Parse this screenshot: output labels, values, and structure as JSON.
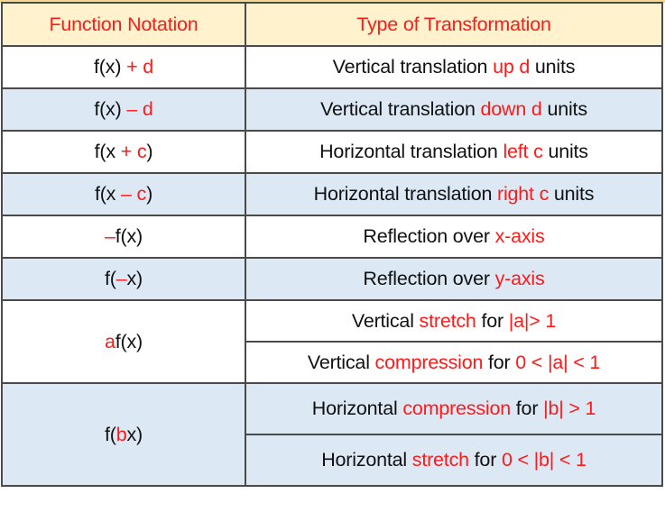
{
  "colors": {
    "header_bg": "#FFF2CC",
    "alt_row_bg": "#DDE8F5",
    "row_bg": "#FFFFFF",
    "accent_red": "#FF0000",
    "border": "#4A4A4A"
  },
  "table": {
    "headers": {
      "function_notation": "Function Notation",
      "type_of_transformation": "Type of Transformation"
    },
    "rows": [
      {
        "notation": [
          {
            "t": "f(x) ",
            "red": false
          },
          {
            "t": "+ d",
            "red": true
          }
        ],
        "transformation": [
          [
            {
              "t": "Vertical translation ",
              "red": false
            },
            {
              "t": "up d",
              "red": true
            },
            {
              "t": " units",
              "red": false
            }
          ]
        ]
      },
      {
        "notation": [
          {
            "t": "f(x) ",
            "red": false
          },
          {
            "t": "– d",
            "red": true
          }
        ],
        "transformation": [
          [
            {
              "t": "Vertical translation ",
              "red": false
            },
            {
              "t": "down d",
              "red": true
            },
            {
              "t": " units",
              "red": false
            }
          ]
        ]
      },
      {
        "notation": [
          {
            "t": "f(x ",
            "red": false
          },
          {
            "t": "+ c",
            "red": true
          },
          {
            "t": ")",
            "red": false
          }
        ],
        "transformation": [
          [
            {
              "t": "Horizontal translation ",
              "red": false
            },
            {
              "t": "left c",
              "red": true
            },
            {
              "t": " units",
              "red": false
            }
          ]
        ]
      },
      {
        "notation": [
          {
            "t": "f(x ",
            "red": false
          },
          {
            "t": "– c",
            "red": true
          },
          {
            "t": ")",
            "red": false
          }
        ],
        "transformation": [
          [
            {
              "t": "Horizontal translation ",
              "red": false
            },
            {
              "t": "right c",
              "red": true
            },
            {
              "t": " units",
              "red": false
            }
          ]
        ]
      },
      {
        "notation": [
          {
            "t": "–",
            "red": true
          },
          {
            "t": "f(x)",
            "red": false
          }
        ],
        "transformation": [
          [
            {
              "t": "Reflection over ",
              "red": false
            },
            {
              "t": "x-axis",
              "red": true
            }
          ]
        ]
      },
      {
        "notation": [
          {
            "t": "f(",
            "red": false
          },
          {
            "t": "–",
            "red": true
          },
          {
            "t": "x)",
            "red": false
          }
        ],
        "transformation": [
          [
            {
              "t": "Reflection over ",
              "red": false
            },
            {
              "t": "y-axis",
              "red": true
            }
          ]
        ]
      },
      {
        "notation": [
          {
            "t": "a",
            "red": true
          },
          {
            "t": "f(x)",
            "red": false
          }
        ],
        "transformation": [
          [
            {
              "t": "Vertical ",
              "red": false
            },
            {
              "t": "stretch",
              "red": true
            },
            {
              "t": " for ",
              "red": false
            },
            {
              "t": "|a|> 1",
              "red": true
            }
          ],
          [
            {
              "t": "Vertical ",
              "red": false
            },
            {
              "t": "compression",
              "red": true
            },
            {
              "t": " for ",
              "red": false
            },
            {
              "t": "0 < |a| < 1",
              "red": true
            }
          ]
        ]
      },
      {
        "notation": [
          {
            "t": "f(",
            "red": false
          },
          {
            "t": "b",
            "red": true
          },
          {
            "t": "x)",
            "red": false
          }
        ],
        "transformation": [
          [
            {
              "t": "Horizontal ",
              "red": false
            },
            {
              "t": "compression",
              "red": true
            },
            {
              "t": " for ",
              "red": false
            },
            {
              "t": "|b| > 1",
              "red": true
            }
          ],
          [
            {
              "t": "Horizontal ",
              "red": false
            },
            {
              "t": "stretch",
              "red": true
            },
            {
              "t": " for ",
              "red": false
            },
            {
              "t": "0 < |b| < 1",
              "red": true
            }
          ]
        ]
      }
    ]
  }
}
